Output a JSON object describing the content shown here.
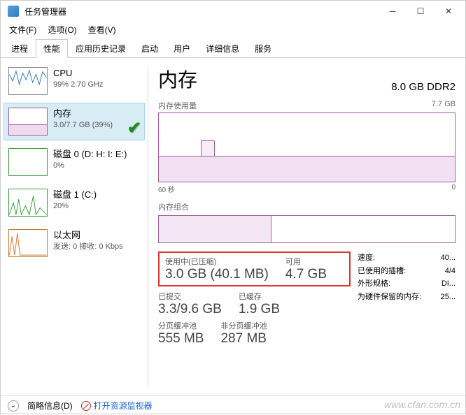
{
  "window": {
    "title": "任务管理器"
  },
  "menu": {
    "file": "文件(F)",
    "options": "选项(O)",
    "view": "查看(V)"
  },
  "tabs": {
    "processes": "进程",
    "performance": "性能",
    "app_history": "应用历史记录",
    "startup": "启动",
    "users": "用户",
    "details": "详细信息",
    "services": "服务"
  },
  "sidebar": {
    "cpu": {
      "name": "CPU",
      "sub": "99% 2.70 GHz"
    },
    "memory": {
      "name": "内存",
      "sub": "3.0/7.7 GB (39%)"
    },
    "disk0": {
      "name": "磁盘 0 (D: H: I: E:)",
      "sub": "0%"
    },
    "disk1": {
      "name": "磁盘 1 (C:)",
      "sub": "20%"
    },
    "ethernet": {
      "name": "以太网",
      "sub": "发送: 0 接收: 0 Kbps"
    }
  },
  "main": {
    "title": "内存",
    "total": "8.0 GB DDR2",
    "usage_label": "内存使用量",
    "usage_max": "7.7 GB",
    "axis_left": "60 秒",
    "axis_right": "0",
    "composition_label": "内存组合",
    "in_use_label": "使用中(已压缩)",
    "in_use_value": "3.0 GB (40.1 MB)",
    "available_label": "可用",
    "available_value": "4.7 GB",
    "committed_label": "已提交",
    "committed_value": "3.3/9.6 GB",
    "cached_label": "已缓存",
    "cached_value": "1.9 GB",
    "paged_label": "分页缓冲池",
    "paged_value": "555 MB",
    "nonpaged_label": "非分页缓冲池",
    "nonpaged_value": "287 MB",
    "speed_label": "速度:",
    "speed_value": "40...",
    "slots_label": "已使用的插槽:",
    "slots_value": "4/4",
    "form_label": "外形规格:",
    "form_value": "DI...",
    "reserved_label": "为硬件保留的内存:",
    "reserved_value": "25..."
  },
  "footer": {
    "simple": "简略信息(D)",
    "resmon": "打开资源监视器"
  },
  "watermark": "www.cfan.com.cn",
  "chart_data": {
    "type": "area",
    "title": "内存使用量",
    "x_range_seconds": [
      60,
      0
    ],
    "y_range_gb": [
      0,
      7.7
    ],
    "baseline_gb": 3.0,
    "series": [
      {
        "name": "内存",
        "approx_constant_gb": 3.0
      }
    ]
  }
}
